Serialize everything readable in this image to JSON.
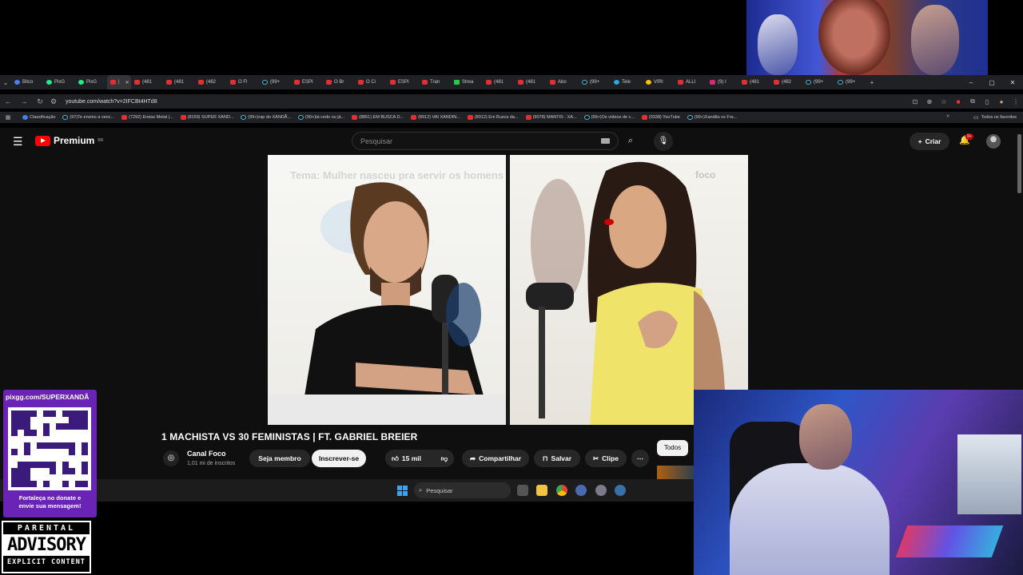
{
  "browser": {
    "tabs": [
      {
        "label": "Bitco",
        "icon": "bl"
      },
      {
        "label": "PixG",
        "icon": "px"
      },
      {
        "label": "PixG",
        "icon": "px"
      },
      {
        "label": "|",
        "icon": "yt",
        "active": true
      },
      {
        "label": "(481",
        "icon": "yt"
      },
      {
        "label": "(481",
        "icon": "yt"
      },
      {
        "label": "(482",
        "icon": "yt"
      },
      {
        "label": "O Fl",
        "icon": "yt"
      },
      {
        "label": "(99+",
        "icon": "tk"
      },
      {
        "label": "ESPI",
        "icon": "yt"
      },
      {
        "label": "O Br",
        "icon": "yt"
      },
      {
        "label": "O Ci",
        "icon": "yt"
      },
      {
        "label": "ESPI",
        "icon": "yt"
      },
      {
        "label": "Tran",
        "icon": "yt"
      },
      {
        "label": "Strea",
        "icon": "gr"
      },
      {
        "label": "(481",
        "icon": "yt"
      },
      {
        "label": "(481",
        "icon": "yt"
      },
      {
        "label": "Abo",
        "icon": "yt"
      },
      {
        "label": "(99+",
        "icon": "tk"
      },
      {
        "label": "Tele",
        "icon": "tg"
      },
      {
        "label": "VIRI",
        "icon": "ch"
      },
      {
        "label": "ALLI",
        "icon": "yt"
      },
      {
        "label": "(9) I",
        "icon": "ig"
      },
      {
        "label": "(481",
        "icon": "yt"
      },
      {
        "label": "(482",
        "icon": "yt"
      },
      {
        "label": "(99+",
        "icon": "tk"
      },
      {
        "label": "(99+",
        "icon": "tk"
      }
    ],
    "url": "youtube.com/watch?v=2IFCBt4HTd8",
    "bookmarks": [
      {
        "label": "Classificação",
        "icon": "bl"
      },
      {
        "label": "(97)Te ensino a venc...",
        "icon": "tk"
      },
      {
        "label": "(7292) Ereias Metal |...",
        "icon": "yt"
      },
      {
        "label": "(8159) SUPER XAND...",
        "icon": "yt"
      },
      {
        "label": "(99+)rap do XANDÃ...",
        "icon": "tk"
      },
      {
        "label": "(99+)tá cedo ou já...",
        "icon": "tk"
      },
      {
        "label": "(8851) EM BUSCA D...",
        "icon": "yt"
      },
      {
        "label": "(8912) VAI XANDIN...",
        "icon": "yt"
      },
      {
        "label": "(8912) Em Busca da...",
        "icon": "yt"
      },
      {
        "label": "(9078) MANTIS - XA...",
        "icon": "yt"
      },
      {
        "label": "(99+)Os vídeos de c...",
        "icon": "tk"
      },
      {
        "label": "(9338) YouTube",
        "icon": "yt"
      },
      {
        "label": "(99+)Xandão vs Fra...",
        "icon": "tk"
      }
    ],
    "all_bookmarks": "Todos os favoritos"
  },
  "youtube": {
    "logo_text": "Premium",
    "logo_region": "BR",
    "search_placeholder": "Pesquisar",
    "create_label": "Criar",
    "notif_badge": "9+",
    "video_caption": "Tema: Mulher nasceu pra servir os homens",
    "video_brand": "foco",
    "title": "1 MACHISTA VS 30 FEMINISTAS | FT. GABRIEL BREIER",
    "channel": "Canal Foco",
    "subscribers": "1,01 mi de inscritos",
    "member_label": "Seja membro",
    "subscribe_label": "Inscrever-se",
    "likes": "15 mil",
    "share_label": "Compartilhar",
    "save_label": "Salvar",
    "clip_label": "Clipe",
    "filter_chip": "Todos"
  },
  "taskbar": {
    "search_placeholder": "Pesquisar"
  },
  "overlay": {
    "pix_url": "pixgg.com/SUPERXANDÃ",
    "pix_message_1": "Fortaleça no donate e",
    "pix_message_2": "envie sua mensagem!",
    "advisory_1": "PARENTAL",
    "advisory_2": "ADVISORY",
    "advisory_3": "EXPLICIT CONTENT"
  },
  "colors": {
    "yt_bg": "#0f0f0f",
    "pix_purple": "#6a24b5",
    "yt_red": "#ff0000"
  }
}
